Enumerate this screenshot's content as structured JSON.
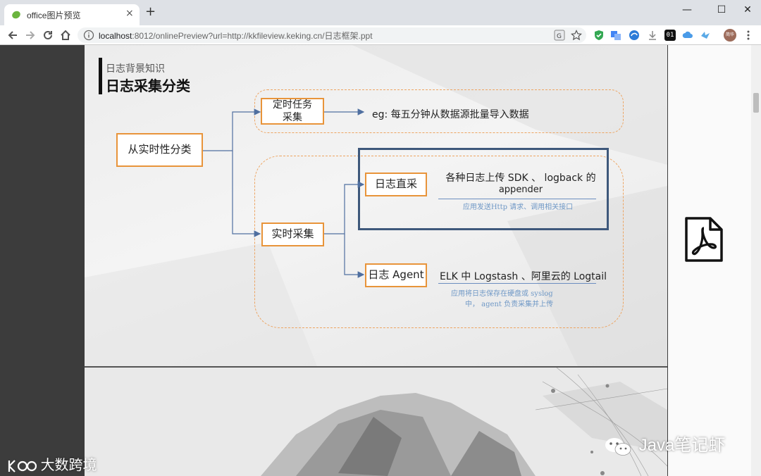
{
  "browser": {
    "tab_title": "office图片预览",
    "tab_close": "×",
    "new_tab": "+",
    "window_controls": {
      "minimize": "—",
      "maximize": "☐",
      "close": "✕"
    },
    "url_host": "localhost",
    "url_rest": ":8012/onlinePreview?url=http://kkfileview.keking.cn/日志框架.ppt",
    "extensions": [
      "translate-icon",
      "star-icon",
      "shield-icon",
      "translate-ext-icon",
      "edge-icon",
      "download-icon",
      "01-icon",
      "cloud-icon",
      "bird-icon",
      "avatar"
    ],
    "ext_01_label": "01",
    "avatar_label": "简华"
  },
  "slide": {
    "heading_sub": "日志背景知识",
    "heading_main": "日志采集分类",
    "root_box": "从实时性分类",
    "timed_box_line1": "定时任务",
    "timed_box_line2": "采集",
    "timed_desc": "eg: 每五分钟从数据源批量导入数据",
    "realtime_box": "实时采集",
    "direct_box": "日志直采",
    "direct_desc_line1": "各种日志上传 SDK 、 logback 的",
    "direct_desc_line2": "appender",
    "direct_sub": "应用发送Http 请求、调用相关接口",
    "agent_box": "日志 Agent",
    "agent_desc": "ELK 中 Logstash 、阿里云的 Logtail",
    "agent_sub_line1": "应用将日志保存在硬盘或 syslog",
    "agent_sub_line2": "中， agent 负责采集并上传"
  },
  "watermarks": {
    "left": "大数跨境",
    "right": "Java笔记虾"
  },
  "colors": {
    "box_border": "#e8943a",
    "connector": "#4f6fa0",
    "highlight_border": "#3e587b",
    "sub_text": "#6f98c6"
  }
}
